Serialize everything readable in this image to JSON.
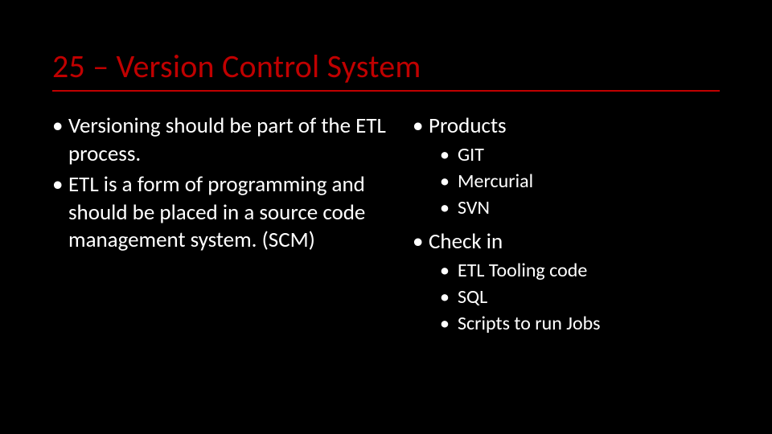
{
  "title": "25 – Version Control System",
  "left": {
    "b1": "Versioning should be part of the ETL process.",
    "b2": "ETL is a form of programming and should be placed in a source code management system. (SCM)"
  },
  "right": {
    "products_label": "Products",
    "products": {
      "p1": "GIT",
      "p2": "Mercurial",
      "p3": "SVN"
    },
    "checkin_label": "Check in",
    "checkin": {
      "c1": "ETL Tooling code",
      "c2": "SQL",
      "c3": "Scripts to run Jobs"
    }
  }
}
